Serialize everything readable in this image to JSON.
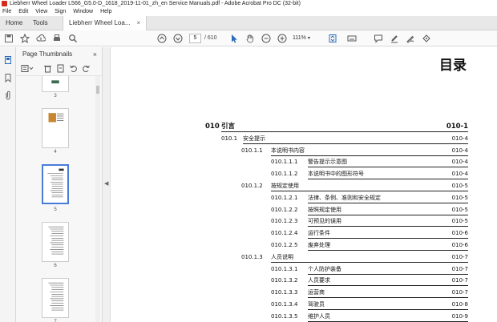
{
  "window": {
    "title": "Liebherr Wheel Loader L566_G5.0-D_1618_2019-11-01_zh_en Service Manuals.pdf - Adobe Acrobat Pro DC (32-bit)"
  },
  "menu": [
    "File",
    "Edit",
    "View",
    "Sign",
    "Window",
    "Help"
  ],
  "tabs": {
    "home": "Home",
    "tools": "Tools",
    "doc": "Liebherr Wheel Loa...",
    "close": "×"
  },
  "toolbar": {
    "page_current": "5",
    "page_total": "/ 610",
    "zoom": "111%"
  },
  "panel": {
    "title": "Page Thumbnails",
    "close": "×",
    "thumb_labels": [
      "3",
      "4",
      "5",
      "6",
      "7"
    ]
  },
  "document": {
    "heading": "目录",
    "toc": [
      {
        "level": 0,
        "num": "010",
        "text": "引言",
        "page": "010-1"
      },
      {
        "level": 1,
        "num": "010.1",
        "text": "安全提示",
        "page": "010-4"
      },
      {
        "level": 2,
        "num": "010.1.1",
        "text": "本说明书内容",
        "page": "010-4"
      },
      {
        "level": 3,
        "num": "010.1.1.1",
        "text": "警告提示示意图",
        "page": "010-4"
      },
      {
        "level": 3,
        "num": "010.1.1.2",
        "text": "本说明书中的图形符号",
        "page": "010-4"
      },
      {
        "level": 2,
        "num": "010.1.2",
        "text": "按规定使用",
        "page": "010-5"
      },
      {
        "level": 3,
        "num": "010.1.2.1",
        "text": "法律、条例、准则和安全规定",
        "page": "010-5"
      },
      {
        "level": 3,
        "num": "010.1.2.2",
        "text": "按照规定使用",
        "page": "010-5"
      },
      {
        "level": 3,
        "num": "010.1.2.3",
        "text": "可预见的误用",
        "page": "010-5"
      },
      {
        "level": 3,
        "num": "010.1.2.4",
        "text": "运行条件",
        "page": "010-6"
      },
      {
        "level": 3,
        "num": "010.1.2.5",
        "text": "废弃处理",
        "page": "010-6"
      },
      {
        "level": 2,
        "num": "010.1.3",
        "text": "人员说明",
        "page": "010-7"
      },
      {
        "level": 3,
        "num": "010.1.3.1",
        "text": "个人防护装备",
        "page": "010-7"
      },
      {
        "level": 3,
        "num": "010.1.3.2",
        "text": "人员要求",
        "page": "010-7"
      },
      {
        "level": 3,
        "num": "010.1.3.3",
        "text": "运营商",
        "page": "010-7"
      },
      {
        "level": 3,
        "num": "010.1.3.4",
        "text": "驾驶员",
        "page": "010-8"
      },
      {
        "level": 3,
        "num": "010.1.3.5",
        "text": "维护人员",
        "page": "010-9"
      }
    ]
  },
  "colors": {
    "accent": "#4b7bd8",
    "tool_active": "#2a6ab8"
  }
}
